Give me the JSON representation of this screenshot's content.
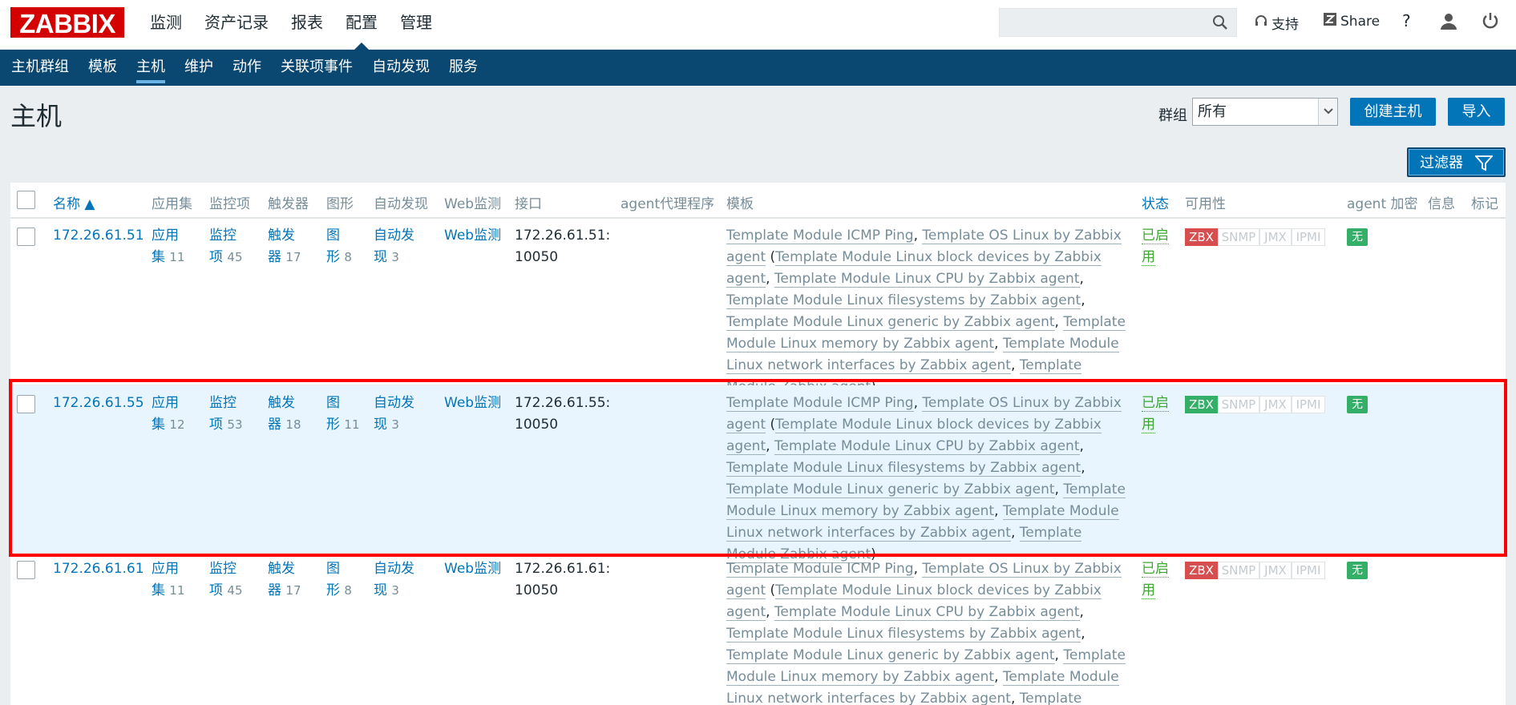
{
  "header": {
    "logo": "ZABBIX",
    "nav": [
      "监测",
      "资产记录",
      "报表",
      "配置",
      "管理"
    ],
    "active_nav": 3,
    "search_placeholder": "",
    "support": "支持",
    "share": "Share",
    "help": "?"
  },
  "subnav": {
    "items": [
      "主机群组",
      "模板",
      "主机",
      "维护",
      "动作",
      "关联项事件",
      "自动发现",
      "服务"
    ],
    "active": 2
  },
  "page": {
    "title": "主机",
    "group_label": "群组",
    "group_value": "所有",
    "create_button": "创建主机",
    "import_button": "导入",
    "filter_button": "过滤器"
  },
  "table": {
    "columns": {
      "name": "名称 ▲",
      "apps": "应用集",
      "items": "监控项",
      "triggers": "触发器",
      "graphs": "图形",
      "discovery": "自动发现",
      "web": "Web监测",
      "interface": "接口",
      "proxy": "agent代理程序",
      "templates": "模板",
      "status": "状态",
      "availability": "可用性",
      "encryption": "agent 加密",
      "info": "信息",
      "tags": "标记"
    },
    "rows": [
      {
        "name": "172.26.61.51",
        "apps_a": "应用",
        "apps_b": "集",
        "apps_n": "11",
        "items_a": "监控",
        "items_b": "项",
        "items_n": "45",
        "triggers_a": "触发",
        "triggers_b": "器",
        "triggers_n": "17",
        "graphs_a": "图",
        "graphs_b": "形",
        "graphs_n": "8",
        "disc_a": "自动发",
        "disc_b": "现",
        "disc_n": "3",
        "web": "Web监测",
        "iface_a": "172.26.61.51:",
        "iface_b": "10050",
        "tpl": [
          "Template Module ICMP Ping",
          "Template OS Linux by Zabbix agent",
          "Template Module Linux block devices by Zabbix agent",
          "Template Module Linux CPU by Zabbix agent",
          "Template Module Linux filesystems by Zabbix agent",
          "Template Module Linux generic by Zabbix agent",
          "Template Module Linux memory by Zabbix agent",
          "Template Module Linux network interfaces by Zabbix agent",
          "Template Module Zabbix agent"
        ],
        "status_a": "已启",
        "status_b": "用",
        "zbx": "ZBX",
        "snmp": "SNMP",
        "jmx": "JMX",
        "ipmi": "IPMI",
        "zbx_state": "red",
        "enc": "无"
      },
      {
        "name": "172.26.61.55",
        "apps_a": "应用",
        "apps_b": "集",
        "apps_n": "12",
        "items_a": "监控",
        "items_b": "项",
        "items_n": "53",
        "triggers_a": "触发",
        "triggers_b": "器",
        "triggers_n": "18",
        "graphs_a": "图",
        "graphs_b": "形",
        "graphs_n": "11",
        "disc_a": "自动发",
        "disc_b": "现",
        "disc_n": "3",
        "web": "Web监测",
        "iface_a": "172.26.61.55:",
        "iface_b": "10050",
        "tpl": [
          "Template Module ICMP Ping",
          "Template OS Linux by Zabbix agent",
          "Template Module Linux block devices by Zabbix agent",
          "Template Module Linux CPU by Zabbix agent",
          "Template Module Linux filesystems by Zabbix agent",
          "Template Module Linux generic by Zabbix agent",
          "Template Module Linux memory by Zabbix agent",
          "Template Module Linux network interfaces by Zabbix agent",
          "Template Module Zabbix agent"
        ],
        "status_a": "已启",
        "status_b": "用",
        "zbx": "ZBX",
        "snmp": "SNMP",
        "jmx": "JMX",
        "ipmi": "IPMI",
        "zbx_state": "green",
        "enc": "无"
      },
      {
        "name": "172.26.61.61",
        "apps_a": "应用",
        "apps_b": "集",
        "apps_n": "11",
        "items_a": "监控",
        "items_b": "项",
        "items_n": "45",
        "triggers_a": "触发",
        "triggers_b": "器",
        "triggers_n": "17",
        "graphs_a": "图",
        "graphs_b": "形",
        "graphs_n": "8",
        "disc_a": "自动发",
        "disc_b": "现",
        "disc_n": "3",
        "web": "Web监测",
        "iface_a": "172.26.61.61:",
        "iface_b": "10050",
        "tpl": [
          "Template Module ICMP Ping",
          "Template OS Linux by Zabbix agent",
          "Template Module Linux block devices by Zabbix agent",
          "Template Module Linux CPU by Zabbix agent",
          "Template Module Linux filesystems by Zabbix agent",
          "Template Module Linux generic by Zabbix agent",
          "Template Module Linux memory by Zabbix agent",
          "Template Module Linux network interfaces by Zabbix agent",
          "Template Module Zabbix agent"
        ],
        "status_a": "已启",
        "status_b": "用",
        "zbx": "ZBX",
        "snmp": "SNMP",
        "jmx": "JMX",
        "ipmi": "IPMI",
        "zbx_state": "red",
        "enc": "无"
      }
    ]
  },
  "colors": {
    "brand": "#d40000",
    "nav_bg": "#0b4871",
    "link": "#0275b8",
    "enabled": "#3ca830",
    "highlight_border": "#ff0000"
  }
}
